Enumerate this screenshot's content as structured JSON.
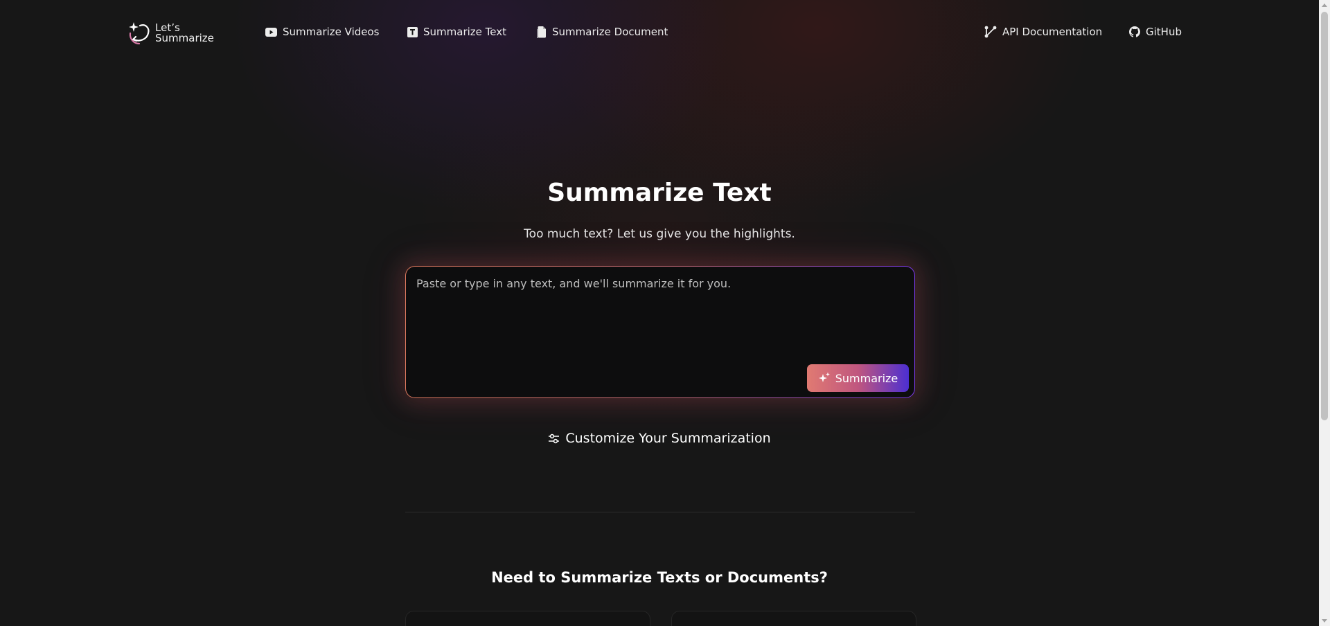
{
  "brand": {
    "line1": "Let’s",
    "line2": "Summarize"
  },
  "nav": {
    "left": [
      {
        "label": "Summarize Videos",
        "icon": "youtube-icon"
      },
      {
        "label": "Summarize Text",
        "icon": "text-icon"
      },
      {
        "label": "Summarize Document",
        "icon": "document-icon"
      }
    ],
    "right": [
      {
        "label": "API Documentation",
        "icon": "api-icon"
      },
      {
        "label": "GitHub",
        "icon": "github-icon"
      }
    ]
  },
  "hero": {
    "title": "Summarize Text",
    "subtitle": "Too much text? Let us give you the highlights."
  },
  "input": {
    "placeholder": "Paste or type in any text, and we'll summarize it for you.",
    "value": ""
  },
  "summarize_button": {
    "label": "Summarize",
    "icon": "sparkle-icon"
  },
  "customize": {
    "label": "Customize Your Summarization",
    "icon": "sliders-icon"
  },
  "section": {
    "title": "Need to Summarize Texts or Documents?"
  },
  "colors": {
    "background": "#171717",
    "card": "#0d0d0e",
    "gradient_start": "#e07a72",
    "gradient_end": "#4c2fd1"
  }
}
